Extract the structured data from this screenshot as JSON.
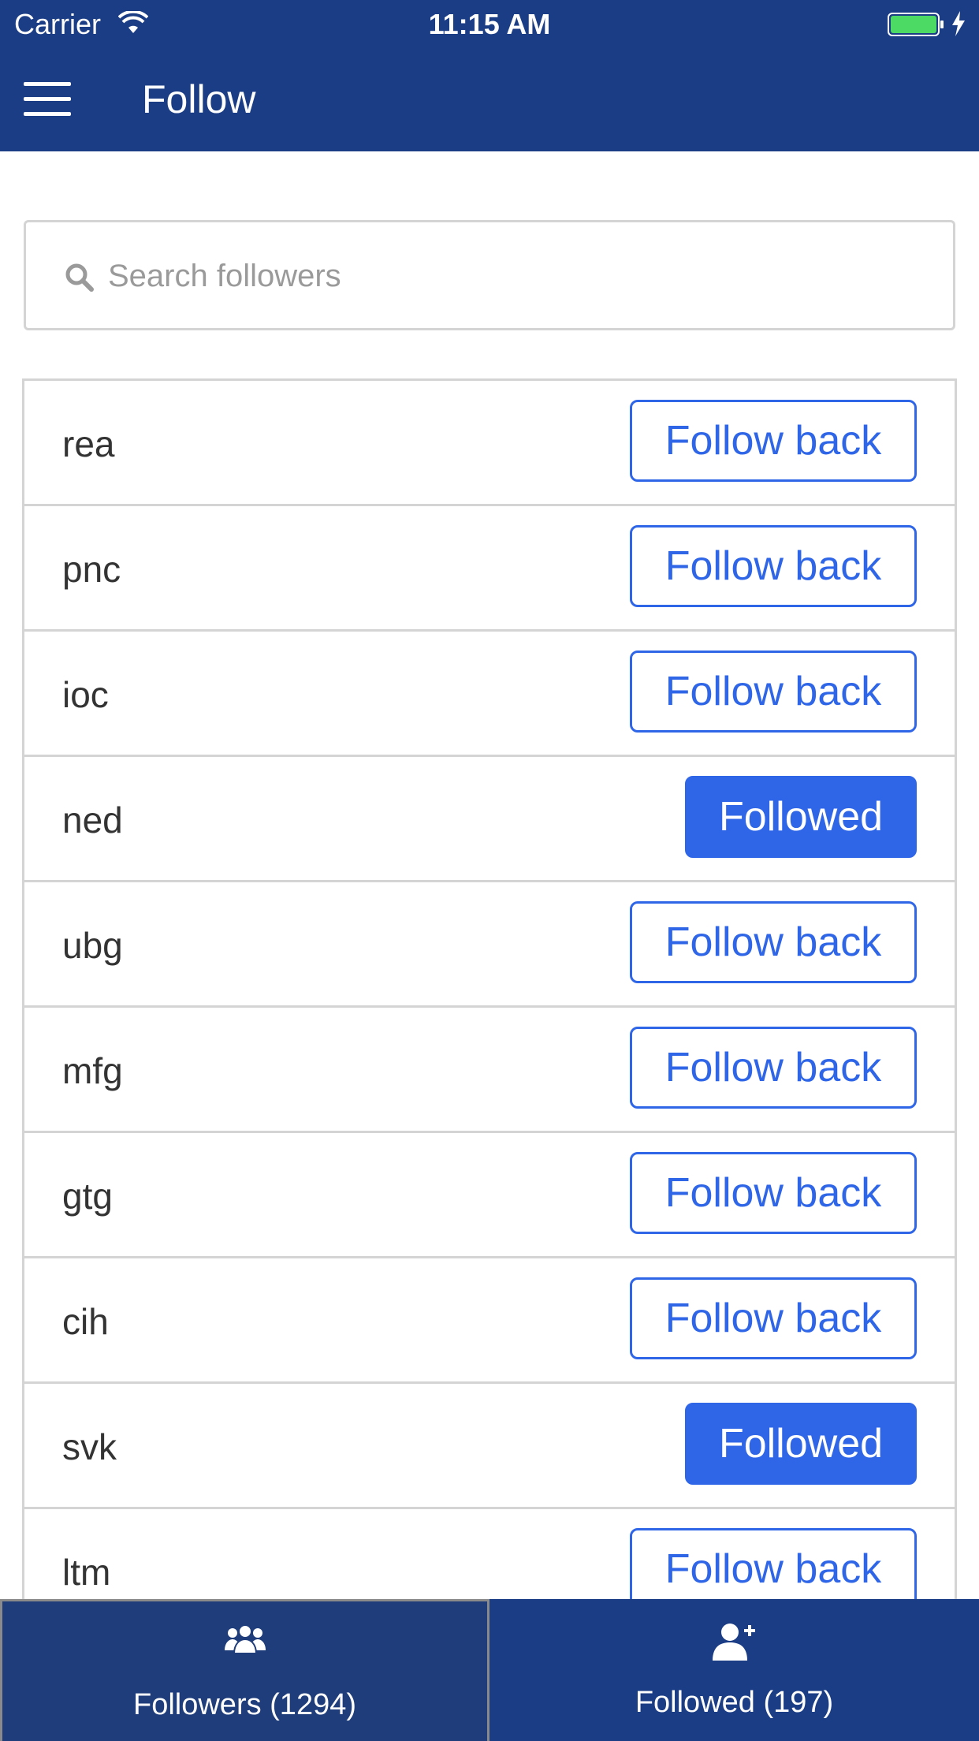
{
  "status_bar": {
    "carrier": "Carrier",
    "time": "11:15 AM"
  },
  "nav": {
    "title": "Follow"
  },
  "search": {
    "placeholder": "Search followers",
    "value": ""
  },
  "followers": [
    {
      "name": "rea",
      "button": "Follow back",
      "state": "follow"
    },
    {
      "name": "pnc",
      "button": "Follow back",
      "state": "follow"
    },
    {
      "name": "ioc",
      "button": "Follow back",
      "state": "follow"
    },
    {
      "name": "ned",
      "button": "Followed",
      "state": "followed"
    },
    {
      "name": "ubg",
      "button": "Follow back",
      "state": "follow"
    },
    {
      "name": "mfg",
      "button": "Follow back",
      "state": "follow"
    },
    {
      "name": "gtg",
      "button": "Follow back",
      "state": "follow"
    },
    {
      "name": "cih",
      "button": "Follow back",
      "state": "follow"
    },
    {
      "name": "svk",
      "button": "Followed",
      "state": "followed"
    },
    {
      "name": "ltm",
      "button": "Follow back",
      "state": "follow"
    }
  ],
  "tabs": [
    {
      "label": "Followers (1294)",
      "icon": "users-icon",
      "active": true
    },
    {
      "label": "Followed (197)",
      "icon": "user-plus-icon",
      "active": false
    }
  ],
  "colors": {
    "header_bg": "#1b3d85",
    "accent": "#2f66e8",
    "border": "#d4d4d4",
    "battery": "#4cd964"
  }
}
